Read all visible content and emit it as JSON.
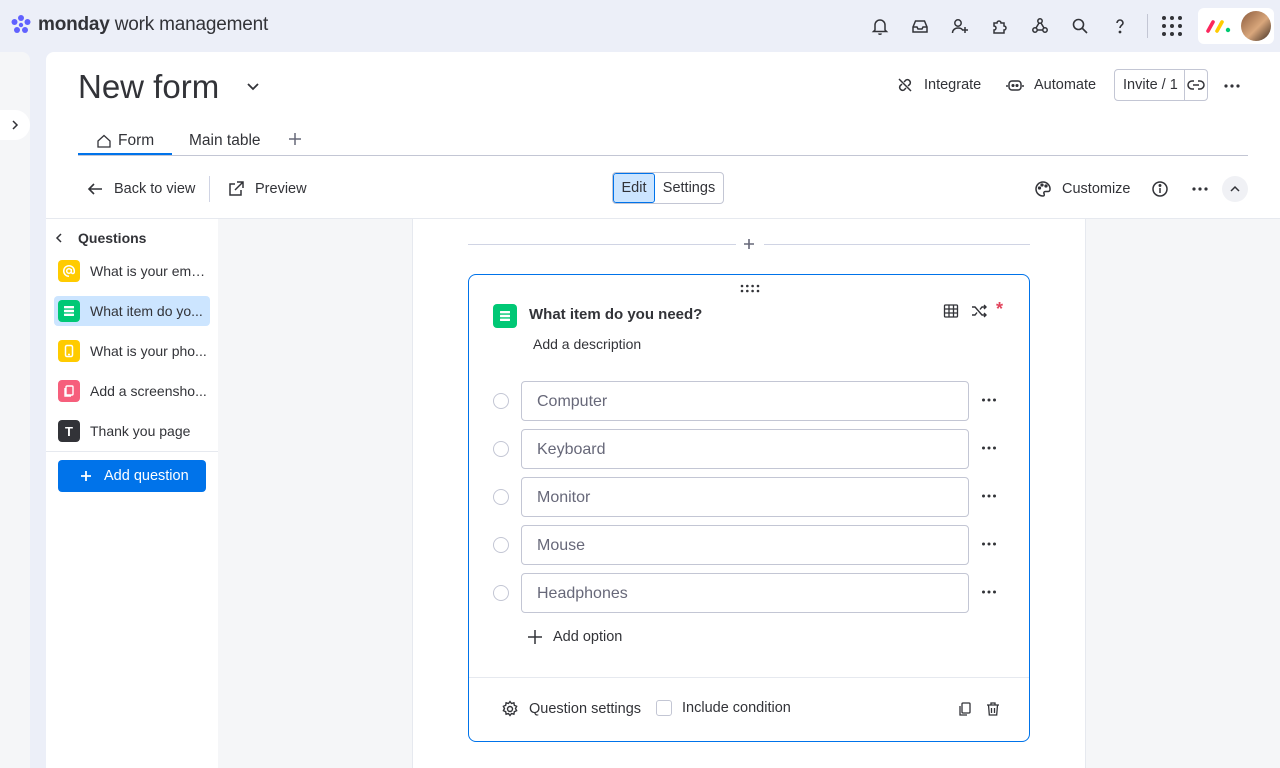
{
  "app": {
    "brand_bold": "monday",
    "brand_rest": " work management"
  },
  "topbar_icons": [
    "bell-icon",
    "inbox-icon",
    "invite-user-icon",
    "apps-puzzle-icon",
    "integrations-icon",
    "search-icon",
    "help-icon",
    "app-grid-icon"
  ],
  "header": {
    "title": "New form",
    "integrate": "Integrate",
    "automate": "Automate",
    "invite": "Invite / 1"
  },
  "tabs": [
    {
      "label": "Form",
      "active": true
    },
    {
      "label": "Main table",
      "active": false
    }
  ],
  "toolbar": {
    "back": "Back to view",
    "preview": "Preview",
    "edit": "Edit",
    "settings": "Settings",
    "customize": "Customize"
  },
  "sidebar": {
    "heading": "Questions",
    "items": [
      {
        "label": "What is your ema...",
        "icon": "at-sign-icon",
        "color": "#ffcb00"
      },
      {
        "label": "What item do yo...",
        "icon": "list-icon",
        "color": "#00c875",
        "active": true
      },
      {
        "label": "What is your pho...",
        "icon": "phone-icon",
        "color": "#ffcb00"
      },
      {
        "label": "Add a screensho...",
        "icon": "file-icon",
        "color": "#f65f7c"
      },
      {
        "label": "Thank you page",
        "icon": "text-icon",
        "color": "#323338",
        "glyph": "T"
      }
    ],
    "add_question": "Add question"
  },
  "question": {
    "title": "What item do you need?",
    "description": "Add a description",
    "required_mark": "*",
    "options": [
      "Computer",
      "Keyboard",
      "Monitor",
      "Mouse",
      "Headphones"
    ],
    "add_option": "Add option",
    "question_settings": "Question settings",
    "include_condition": "Include condition"
  },
  "colors": {
    "accent": "#0073ea",
    "accent_light": "#cce5ff",
    "required": "#e2445c",
    "status_green": "#00c875"
  }
}
